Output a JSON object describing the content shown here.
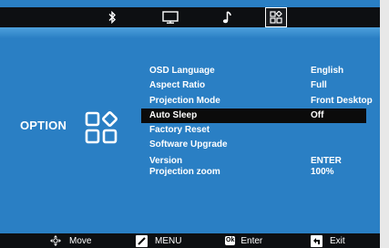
{
  "top_tabs": [
    {
      "icon": "bluetooth-icon"
    },
    {
      "icon": "monitor-icon"
    },
    {
      "icon": "music-note-icon"
    },
    {
      "icon": "option-grid-icon",
      "selected": true
    }
  ],
  "section": {
    "label": "OPTION",
    "icon": "option-grid-icon"
  },
  "menu": {
    "items": [
      {
        "label": "OSD Language",
        "value": "English"
      },
      {
        "label": "Aspect Ratio",
        "value": "Full"
      },
      {
        "label": "Projection Mode",
        "value": "Front Desktop"
      },
      {
        "label": "Auto Sleep",
        "value": "Off",
        "highlighted": true
      },
      {
        "label": "Factory Reset",
        "value": ""
      },
      {
        "label": "Software Upgrade",
        "value": ""
      },
      {
        "label": "Version",
        "value": "ENTER"
      },
      {
        "label": "Projection zoom",
        "value": "100%"
      }
    ]
  },
  "bottom_hints": {
    "move": "Move",
    "menu": "MENU",
    "enter_key": "Ok",
    "enter": "Enter",
    "exit": "Exit"
  },
  "colors": {
    "panel": "#2a7fc4",
    "bar": "#0d0f12",
    "highlight": "#0b0b0b",
    "text": "#ffffff"
  }
}
